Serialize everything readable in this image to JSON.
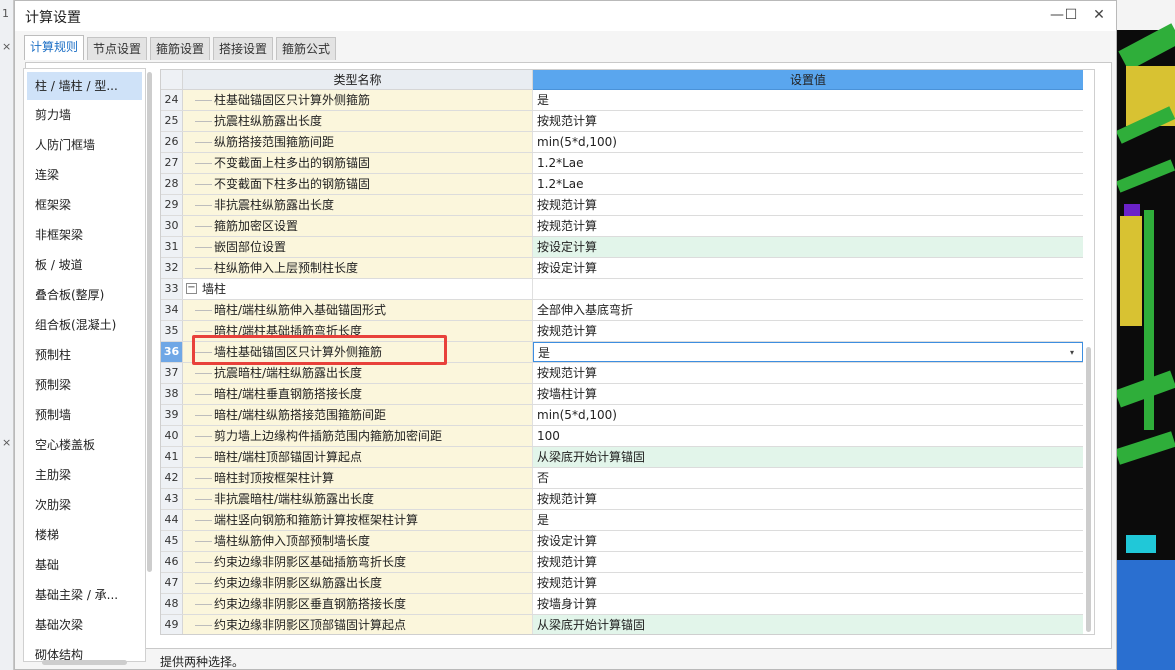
{
  "window": {
    "title": "计算设置",
    "minimize_glyph": "—",
    "maximize_glyph": "☐",
    "close_glyph": "✕"
  },
  "bg_left": {
    "marks": [
      "1",
      "×",
      "×"
    ]
  },
  "tabs": [
    {
      "label": "计算规则",
      "active": true
    },
    {
      "label": "节点设置",
      "active": false
    },
    {
      "label": "箍筋设置",
      "active": false
    },
    {
      "label": "搭接设置",
      "active": false
    },
    {
      "label": "箍筋公式",
      "active": false
    }
  ],
  "categories": [
    {
      "label": "柱 / 墙柱 / 型...",
      "selected": true
    },
    {
      "label": "剪力墙"
    },
    {
      "label": "人防门框墙"
    },
    {
      "label": "连梁"
    },
    {
      "label": "框架梁"
    },
    {
      "label": "非框架梁"
    },
    {
      "label": "板 / 坡道"
    },
    {
      "label": "叠合板(整厚)"
    },
    {
      "label": "组合板(混凝土)"
    },
    {
      "label": "预制柱"
    },
    {
      "label": "预制梁"
    },
    {
      "label": "预制墙"
    },
    {
      "label": "空心楼盖板"
    },
    {
      "label": "主肋梁"
    },
    {
      "label": "次肋梁"
    },
    {
      "label": "楼梯"
    },
    {
      "label": "基础"
    },
    {
      "label": "基础主梁 / 承..."
    },
    {
      "label": "基础次梁"
    },
    {
      "label": "砌体结构"
    }
  ],
  "grid": {
    "col_name": "类型名称",
    "col_value": "设置值",
    "rows": [
      {
        "n": "24",
        "name": "柱基础锚固区只计算外侧箍筋",
        "value": "是"
      },
      {
        "n": "25",
        "name": "抗震柱纵筋露出长度",
        "value": "按规范计算"
      },
      {
        "n": "26",
        "name": "纵筋搭接范围箍筋间距",
        "value": "min(5*d,100)"
      },
      {
        "n": "27",
        "name": "不变截面上柱多出的钢筋锚固",
        "value": "1.2*Lae"
      },
      {
        "n": "28",
        "name": "不变截面下柱多出的钢筋锚固",
        "value": "1.2*Lae"
      },
      {
        "n": "29",
        "name": "非抗震柱纵筋露出长度",
        "value": "按规范计算"
      },
      {
        "n": "30",
        "name": "箍筋加密区设置",
        "value": "按规范计算"
      },
      {
        "n": "31",
        "name": "嵌固部位设置",
        "value": "按设定计算",
        "green": true
      },
      {
        "n": "32",
        "name": "柱纵筋伸入上层预制柱长度",
        "value": "按设定计算"
      },
      {
        "n": "33",
        "name": "墙柱",
        "value": "",
        "group": true,
        "toggle": "−"
      },
      {
        "n": "34",
        "name": "暗柱/端柱纵筋伸入基础锚固形式",
        "value": "全部伸入基底弯折"
      },
      {
        "n": "35",
        "name": "暗柱/端柱基础插筋弯折长度",
        "value": "按规范计算"
      },
      {
        "n": "36",
        "name": "墙柱基础锚固区只计算外侧箍筋",
        "value": "是",
        "current": true,
        "dropdown": "▾"
      },
      {
        "n": "37",
        "name": "抗震暗柱/端柱纵筋露出长度",
        "value": "按规范计算"
      },
      {
        "n": "38",
        "name": "暗柱/端柱垂直钢筋搭接长度",
        "value": "按墙柱计算"
      },
      {
        "n": "39",
        "name": "暗柱/端柱纵筋搭接范围箍筋间距",
        "value": "min(5*d,100)"
      },
      {
        "n": "40",
        "name": "剪力墙上边缘构件插筋范围内箍筋加密间距",
        "value": "100"
      },
      {
        "n": "41",
        "name": "暗柱/端柱顶部锚固计算起点",
        "value": "从梁底开始计算锚固",
        "green": true
      },
      {
        "n": "42",
        "name": "暗柱封顶按框架柱计算",
        "value": "否"
      },
      {
        "n": "43",
        "name": "非抗震暗柱/端柱纵筋露出长度",
        "value": "按规范计算"
      },
      {
        "n": "44",
        "name": "端柱竖向钢筋和箍筋计算按框架柱计算",
        "value": "是"
      },
      {
        "n": "45",
        "name": "墙柱纵筋伸入顶部预制墙长度",
        "value": "按设定计算"
      },
      {
        "n": "46",
        "name": "约束边缘非阴影区基础插筋弯折长度",
        "value": "按规范计算"
      },
      {
        "n": "47",
        "name": "约束边缘非阴影区纵筋露出长度",
        "value": "按规范计算"
      },
      {
        "n": "48",
        "name": "约束边缘非阴影区垂直钢筋搭接长度",
        "value": "按墙身计算"
      },
      {
        "n": "49",
        "name": "约束边缘非阴影区顶部锚固计算起点",
        "value": "从梁底开始计算锚固",
        "green": true
      }
    ]
  },
  "description": "提供两种选择。",
  "colors": {
    "accent": "#1c6fc5",
    "header_blue": "#5aa6ee",
    "name_cell": "#fbf6dc",
    "value_green": "#e2f5ea",
    "highlight_red": "#e8413b"
  }
}
